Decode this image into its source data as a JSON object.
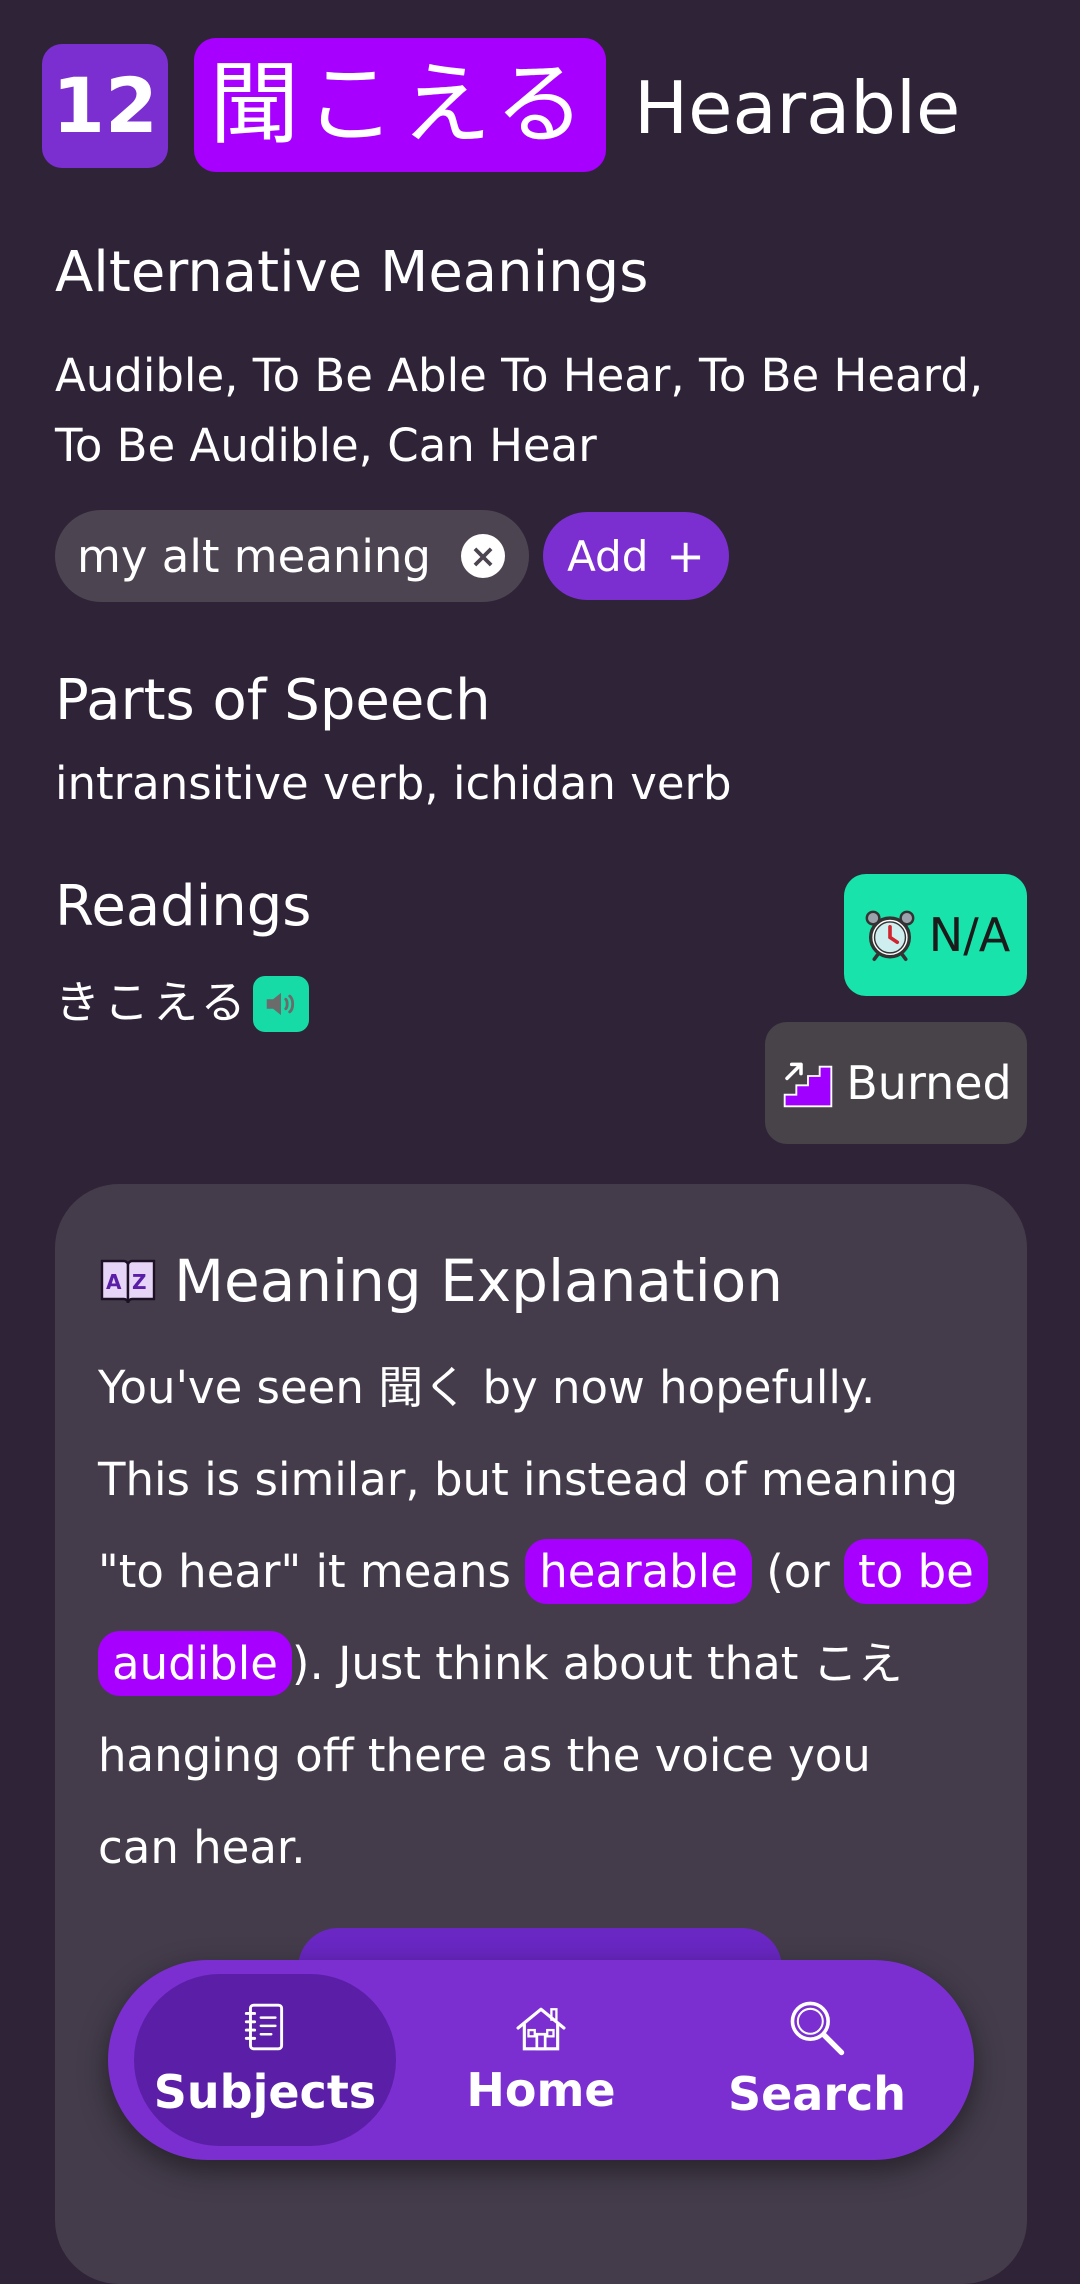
{
  "header": {
    "level": "12",
    "characters": "聞こえる",
    "meaning": "Hearable"
  },
  "alternative_meanings": {
    "heading": "Alternative Meanings",
    "text_line1": "Audible, To Be Able To Hear, To Be Heard,",
    "text_line2": "To Be Audible, Can Hear",
    "user_chip": "my alt meaning",
    "add_label": "Add",
    "add_icon": "+",
    "remove_icon": "×"
  },
  "parts_of_speech": {
    "heading": "Parts of Speech",
    "text": "intransitive verb, ichidan verb"
  },
  "readings": {
    "heading": "Readings",
    "reading": "きこえる"
  },
  "status": {
    "review_label": "N/A",
    "srs_label": "Burned"
  },
  "meaning_explanation": {
    "heading": "Meaning Explanation",
    "p1": "You've seen 聞く by now hopefully.",
    "p2": "This is similar, but instead of meaning",
    "p3a": "\"to hear\" it means ",
    "hl1": "hearable",
    "p3b": " (or ",
    "hl2": "to be",
    "hl3": "audible",
    "p4a": "). Just think about that こえ",
    "p5": "hanging off there as the voice you",
    "p6": "can hear."
  },
  "nav": {
    "items": [
      {
        "label": "Subjects",
        "icon": "notebook-icon"
      },
      {
        "label": "Home",
        "icon": "house-icon"
      },
      {
        "label": "Search",
        "icon": "magnifier-icon"
      }
    ]
  },
  "colors": {
    "background": "#2f2338",
    "accent_purple": "#a800ff",
    "brand_purple": "#7b2fd0",
    "mint": "#17e3aa",
    "card": "#443c4b"
  }
}
